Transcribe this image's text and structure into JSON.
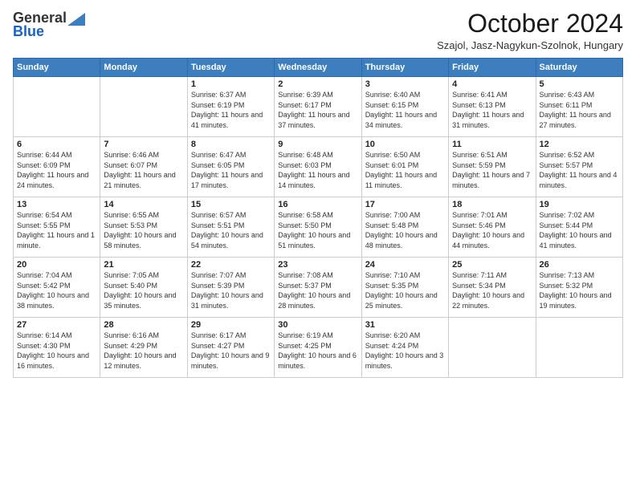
{
  "logo": {
    "general": "General",
    "blue": "Blue"
  },
  "title": "October 2024",
  "location": "Szajol, Jasz-Nagykun-Szolnok, Hungary",
  "days_of_week": [
    "Sunday",
    "Monday",
    "Tuesday",
    "Wednesday",
    "Thursday",
    "Friday",
    "Saturday"
  ],
  "weeks": [
    [
      {
        "day": "",
        "info": ""
      },
      {
        "day": "",
        "info": ""
      },
      {
        "day": "1",
        "info": "Sunrise: 6:37 AM\nSunset: 6:19 PM\nDaylight: 11 hours and 41 minutes."
      },
      {
        "day": "2",
        "info": "Sunrise: 6:39 AM\nSunset: 6:17 PM\nDaylight: 11 hours and 37 minutes."
      },
      {
        "day": "3",
        "info": "Sunrise: 6:40 AM\nSunset: 6:15 PM\nDaylight: 11 hours and 34 minutes."
      },
      {
        "day": "4",
        "info": "Sunrise: 6:41 AM\nSunset: 6:13 PM\nDaylight: 11 hours and 31 minutes."
      },
      {
        "day": "5",
        "info": "Sunrise: 6:43 AM\nSunset: 6:11 PM\nDaylight: 11 hours and 27 minutes."
      }
    ],
    [
      {
        "day": "6",
        "info": "Sunrise: 6:44 AM\nSunset: 6:09 PM\nDaylight: 11 hours and 24 minutes."
      },
      {
        "day": "7",
        "info": "Sunrise: 6:46 AM\nSunset: 6:07 PM\nDaylight: 11 hours and 21 minutes."
      },
      {
        "day": "8",
        "info": "Sunrise: 6:47 AM\nSunset: 6:05 PM\nDaylight: 11 hours and 17 minutes."
      },
      {
        "day": "9",
        "info": "Sunrise: 6:48 AM\nSunset: 6:03 PM\nDaylight: 11 hours and 14 minutes."
      },
      {
        "day": "10",
        "info": "Sunrise: 6:50 AM\nSunset: 6:01 PM\nDaylight: 11 hours and 11 minutes."
      },
      {
        "day": "11",
        "info": "Sunrise: 6:51 AM\nSunset: 5:59 PM\nDaylight: 11 hours and 7 minutes."
      },
      {
        "day": "12",
        "info": "Sunrise: 6:52 AM\nSunset: 5:57 PM\nDaylight: 11 hours and 4 minutes."
      }
    ],
    [
      {
        "day": "13",
        "info": "Sunrise: 6:54 AM\nSunset: 5:55 PM\nDaylight: 11 hours and 1 minute."
      },
      {
        "day": "14",
        "info": "Sunrise: 6:55 AM\nSunset: 5:53 PM\nDaylight: 10 hours and 58 minutes."
      },
      {
        "day": "15",
        "info": "Sunrise: 6:57 AM\nSunset: 5:51 PM\nDaylight: 10 hours and 54 minutes."
      },
      {
        "day": "16",
        "info": "Sunrise: 6:58 AM\nSunset: 5:50 PM\nDaylight: 10 hours and 51 minutes."
      },
      {
        "day": "17",
        "info": "Sunrise: 7:00 AM\nSunset: 5:48 PM\nDaylight: 10 hours and 48 minutes."
      },
      {
        "day": "18",
        "info": "Sunrise: 7:01 AM\nSunset: 5:46 PM\nDaylight: 10 hours and 44 minutes."
      },
      {
        "day": "19",
        "info": "Sunrise: 7:02 AM\nSunset: 5:44 PM\nDaylight: 10 hours and 41 minutes."
      }
    ],
    [
      {
        "day": "20",
        "info": "Sunrise: 7:04 AM\nSunset: 5:42 PM\nDaylight: 10 hours and 38 minutes."
      },
      {
        "day": "21",
        "info": "Sunrise: 7:05 AM\nSunset: 5:40 PM\nDaylight: 10 hours and 35 minutes."
      },
      {
        "day": "22",
        "info": "Sunrise: 7:07 AM\nSunset: 5:39 PM\nDaylight: 10 hours and 31 minutes."
      },
      {
        "day": "23",
        "info": "Sunrise: 7:08 AM\nSunset: 5:37 PM\nDaylight: 10 hours and 28 minutes."
      },
      {
        "day": "24",
        "info": "Sunrise: 7:10 AM\nSunset: 5:35 PM\nDaylight: 10 hours and 25 minutes."
      },
      {
        "day": "25",
        "info": "Sunrise: 7:11 AM\nSunset: 5:34 PM\nDaylight: 10 hours and 22 minutes."
      },
      {
        "day": "26",
        "info": "Sunrise: 7:13 AM\nSunset: 5:32 PM\nDaylight: 10 hours and 19 minutes."
      }
    ],
    [
      {
        "day": "27",
        "info": "Sunrise: 6:14 AM\nSunset: 4:30 PM\nDaylight: 10 hours and 16 minutes."
      },
      {
        "day": "28",
        "info": "Sunrise: 6:16 AM\nSunset: 4:29 PM\nDaylight: 10 hours and 12 minutes."
      },
      {
        "day": "29",
        "info": "Sunrise: 6:17 AM\nSunset: 4:27 PM\nDaylight: 10 hours and 9 minutes."
      },
      {
        "day": "30",
        "info": "Sunrise: 6:19 AM\nSunset: 4:25 PM\nDaylight: 10 hours and 6 minutes."
      },
      {
        "day": "31",
        "info": "Sunrise: 6:20 AM\nSunset: 4:24 PM\nDaylight: 10 hours and 3 minutes."
      },
      {
        "day": "",
        "info": ""
      },
      {
        "day": "",
        "info": ""
      }
    ]
  ]
}
